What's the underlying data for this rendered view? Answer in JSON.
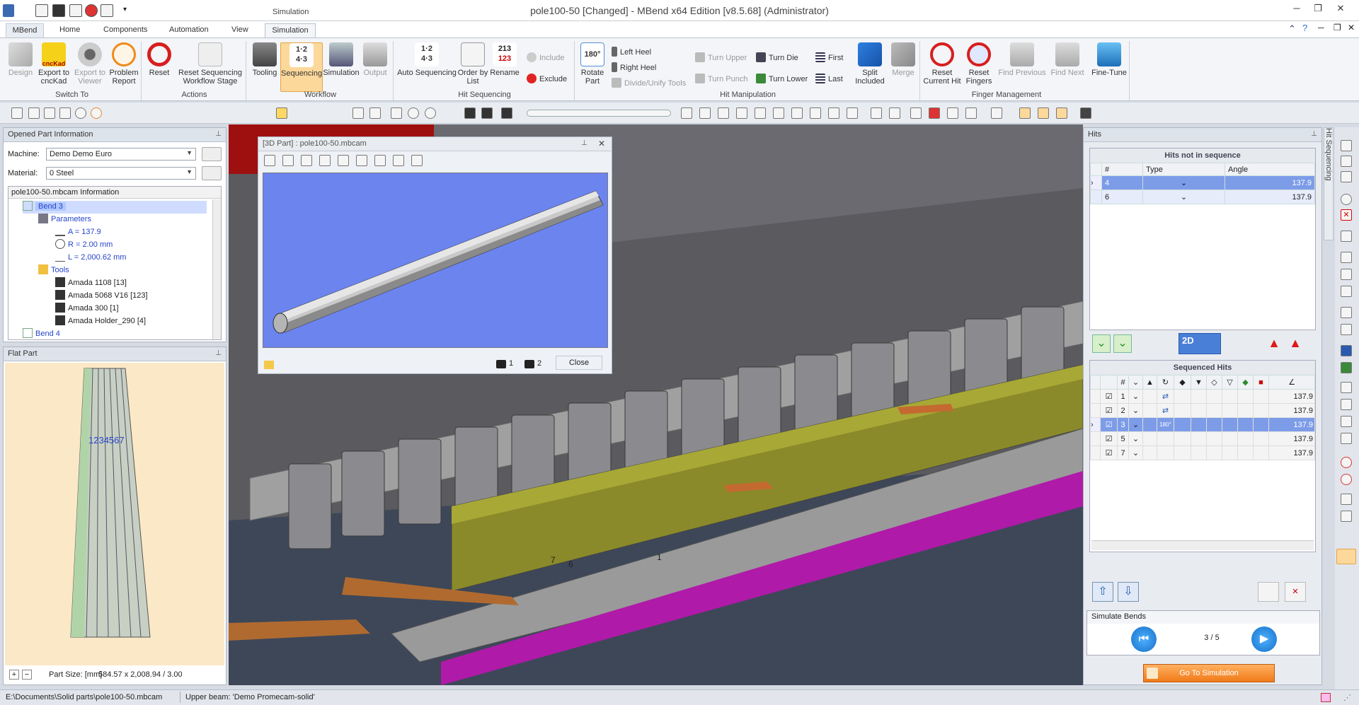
{
  "app": {
    "title": "pole100-50 [Changed] - MBend x64 Edition [v8.5.68] (Administrator)",
    "context_tab": "Simulation"
  },
  "tabs": [
    "MBend",
    "Home",
    "Components",
    "Automation",
    "View",
    "Simulation"
  ],
  "ribbon": {
    "switch_to": {
      "label": "Switch To",
      "buttons": [
        "Design",
        "Export to cncKad",
        "Export to Viewer",
        "Problem Report"
      ]
    },
    "actions": {
      "label": "Actions",
      "buttons": [
        "Reset",
        "Reset Sequencing Workflow Stage"
      ]
    },
    "workflow": {
      "label": "Workflow",
      "buttons": [
        "Tooling",
        "Sequencing",
        "Simulation",
        "Output"
      ]
    },
    "hit_sequencing": {
      "label": "Hit Sequencing",
      "buttons": [
        "Auto Sequencing",
        "Order by List",
        "Rename"
      ],
      "small": [
        "Include",
        "Exclude"
      ]
    },
    "hit_manipulation": {
      "label": "Hit Manipulation",
      "big": [
        "Rotate Part",
        "Split Included",
        "Merge"
      ],
      "small": [
        "Left Heel",
        "Right Heel",
        "Divide/Unify Tools",
        "Turn Upper",
        "Turn Punch",
        "Turn Die",
        "Turn Lower",
        "First",
        "Last"
      ]
    },
    "finger_management": {
      "label": "Finger Management",
      "buttons": [
        "Reset Current Hit",
        "Reset Fingers",
        "Find Previous",
        "Find Next",
        "Fine-Tune"
      ]
    },
    "icon_text": {
      "cnckad": "cncKad",
      "rotate": "180°",
      "seq": [
        "1",
        "2",
        "4",
        "3"
      ],
      "rename": [
        "213",
        "123"
      ]
    }
  },
  "opened_part": {
    "title": "Opened Part Information",
    "machine_label": "Machine:",
    "machine_value": "Demo Demo Euro",
    "material_label": "Material:",
    "material_value": "0 Steel",
    "info_header": "pole100-50.mbcam Information",
    "tree": {
      "bend3": "Bend 3",
      "parameters": "Parameters",
      "a": "A = 137.9",
      "r": "R = 2.00 mm",
      "l": "L = 2,000.62 mm",
      "tools": "Tools",
      "t1": "Amada 1108 [13]",
      "t2": "Amada 5068 V16 [123]",
      "t3": "Amada 300 [1]",
      "t4": "Amada Holder_290 [4]",
      "bend4": "Bend 4"
    }
  },
  "flat_part": {
    "title": "Flat Part",
    "bend_labels": "1234567",
    "part_size_label": "Part Size: [mm]",
    "part_size_value": "584.57 x 2,008.94 / 3.00"
  },
  "part_3d": {
    "title": "[3D Part] : pole100-50.mbcam",
    "cam1": "1",
    "cam2": "2",
    "close": "Close"
  },
  "viewport": {
    "label_7": "7",
    "label_6": "6",
    "label_1": "1"
  },
  "hits": {
    "title": "Hits",
    "side_tab": "Hit Sequencing",
    "not_in_seq_title": "Hits not in sequence",
    "cols": [
      "#",
      "Type",
      "Angle"
    ],
    "not_in_seq": [
      {
        "n": "4",
        "angle": "137.9"
      },
      {
        "n": "6",
        "angle": "137.9"
      }
    ],
    "view_2d": "2D",
    "sequenced_title": "Sequenced Hits",
    "seq_hash": "#",
    "sequenced": [
      {
        "n": "1",
        "angle": "137.9"
      },
      {
        "n": "2",
        "angle": "137.9"
      },
      {
        "n": "3",
        "angle": "137.9",
        "rot": "180°"
      },
      {
        "n": "5",
        "angle": "137.9"
      },
      {
        "n": "7",
        "angle": "137.9"
      }
    ]
  },
  "simulate": {
    "title": "Simulate Bends",
    "counter": "3 / 5",
    "go_button": "Go To Simulation"
  },
  "status": {
    "path": "E:\\Documents\\Solid parts\\pole100-50.mbcam",
    "beam": "Upper beam: 'Demo Promecam-solid'"
  },
  "colors": {
    "ribbon_bg": "#f3f5f8",
    "selected": "#fcd89a",
    "accent_blue": "#3a8be0",
    "viewport_blue": "#6b84ee",
    "flat_bg": "#fbe8c6"
  }
}
